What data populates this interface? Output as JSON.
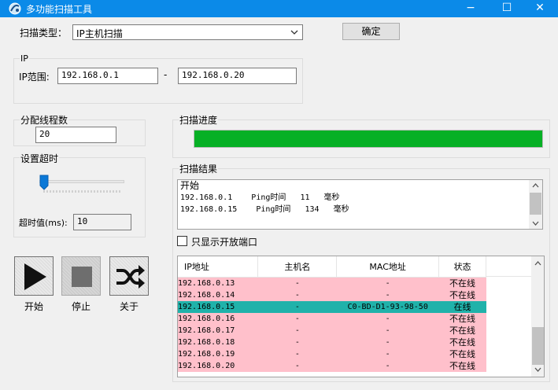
{
  "window": {
    "title": "多功能扫描工具"
  },
  "scan_type": {
    "label": "扫描类型：",
    "value": "IP主机扫描",
    "confirm": "确定"
  },
  "ip": {
    "group_label": "IP",
    "range_label": "IP范围:",
    "start": "192.168.0.1",
    "dash": "-",
    "end": "192.168.0.20"
  },
  "threads": {
    "label": "分配线程数",
    "value": "20"
  },
  "timeout": {
    "label": "设置超时",
    "value_label": "超时值(ms):",
    "value": "10",
    "slider_level": 0.0
  },
  "buttons": {
    "start": "开始",
    "stop": "停止",
    "about": "关于"
  },
  "progress": {
    "label": "扫描进度",
    "percent": 100,
    "color": "#06b025"
  },
  "log": {
    "label": "扫描结果",
    "lines": [
      "开始",
      "192.168.0.1    Ping时间   11   毫秒",
      "192.168.0.15    Ping时间   134   毫秒"
    ]
  },
  "filter": {
    "label": "只显示开放端口",
    "checked": false
  },
  "table": {
    "headers": [
      "IP地址",
      "主机名",
      "MAC地址",
      "状态"
    ],
    "rows": [
      {
        "ip": "192.168.0.13",
        "host": "-",
        "mac": "-",
        "status": "不在线"
      },
      {
        "ip": "192.168.0.14",
        "host": "-",
        "mac": "-",
        "status": "不在线"
      },
      {
        "ip": "192.168.0.15",
        "host": "-",
        "mac": "C0-BD-D1-93-98-50",
        "status": "在线"
      },
      {
        "ip": "192.168.0.16",
        "host": "-",
        "mac": "-",
        "status": "不在线"
      },
      {
        "ip": "192.168.0.17",
        "host": "-",
        "mac": "-",
        "status": "不在线"
      },
      {
        "ip": "192.168.0.18",
        "host": "-",
        "mac": "-",
        "status": "不在线"
      },
      {
        "ip": "192.168.0.19",
        "host": "-",
        "mac": "-",
        "status": "不在线"
      },
      {
        "ip": "192.168.0.20",
        "host": "-",
        "mac": "-",
        "status": "不在线"
      }
    ],
    "online_color": "#20b2aa",
    "offline_color": "#ffc0cb"
  },
  "icons": {
    "minimize": "−",
    "maximize": "☐",
    "close": "✕",
    "dropdown": "chevron-down-icon",
    "scroll_up": "chevron-up-icon",
    "scroll_down": "chevron-down-icon"
  }
}
